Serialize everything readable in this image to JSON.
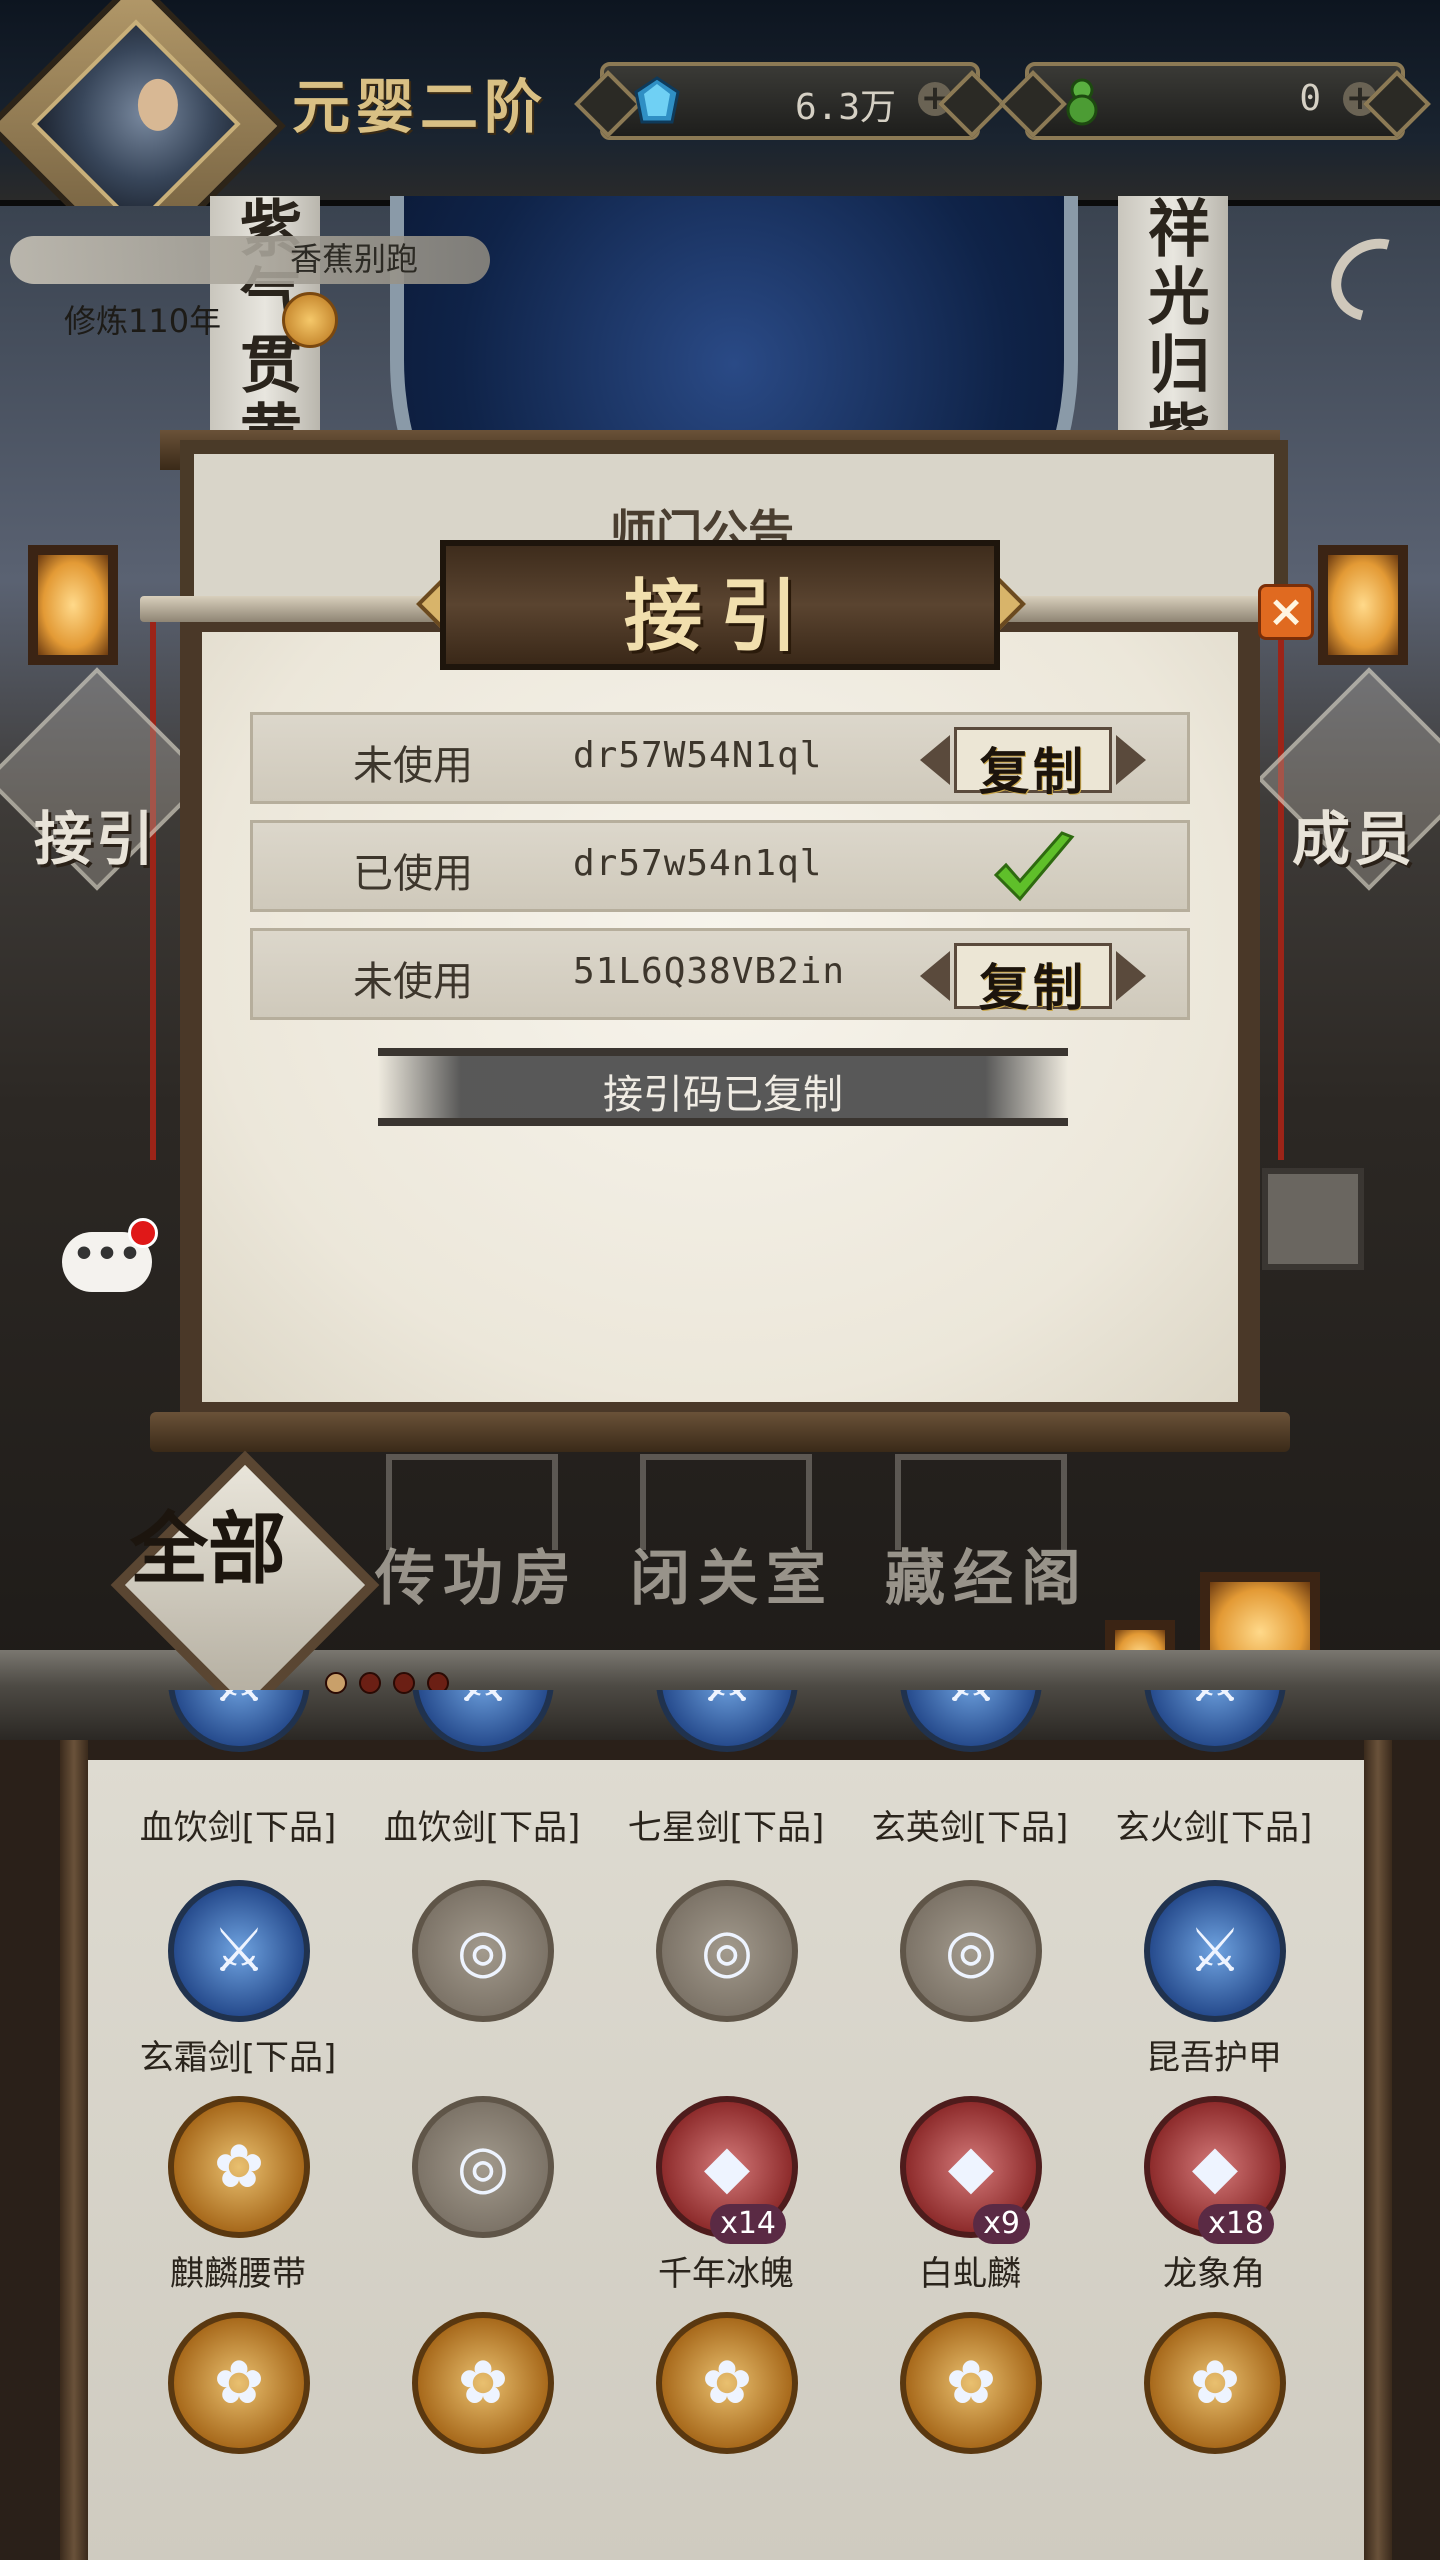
{
  "header": {
    "rank_title": "元婴二阶",
    "resources": [
      {
        "icon": "jade-icon",
        "value": "6.3万"
      },
      {
        "icon": "gourd-icon",
        "value": "0"
      }
    ],
    "plus_symbol": "+"
  },
  "player": {
    "name": "香蕉别跑",
    "cultivation": "修炼110年"
  },
  "scene": {
    "pillar_left_text": "紫气贯黄",
    "pillar_right_text": "祥光归紫",
    "left_side_button": "接引",
    "right_side_button": "成员",
    "notice_board_title": "师门公告"
  },
  "modal": {
    "title": "接引",
    "close_symbol": "×",
    "codes": [
      {
        "status": "未使用",
        "code": "dr57W54N1ql",
        "action": "复制",
        "used": false
      },
      {
        "status": "已使用",
        "code": "dr57w54n1ql",
        "action": "",
        "used": true
      },
      {
        "status": "未使用",
        "code": "51L6Q38VB2in",
        "action": "复制",
        "used": false
      }
    ],
    "toast": "接引码已复制"
  },
  "chat": {
    "bubble": "•••"
  },
  "buildings": {
    "all_tab": "全部",
    "tabs": [
      "传功房",
      "闭关室",
      "藏经阁"
    ],
    "page_count": 4,
    "active_page": 1
  },
  "inventory": {
    "rows": [
      [
        {
          "name": "血饮剑[下品]",
          "style": "blue",
          "count": ""
        },
        {
          "name": "血饮剑[下品]",
          "style": "blue",
          "count": ""
        },
        {
          "name": "七星剑[下品]",
          "style": "blue",
          "count": ""
        },
        {
          "name": "玄英剑[下品]",
          "style": "blue",
          "count": ""
        },
        {
          "name": "玄火剑[下品]",
          "style": "blue",
          "count": ""
        }
      ],
      [
        {
          "name": "玄霜剑[下品]",
          "style": "blue",
          "count": ""
        },
        {
          "name": "",
          "style": "empty",
          "count": ""
        },
        {
          "name": "",
          "style": "empty",
          "count": ""
        },
        {
          "name": "",
          "style": "empty",
          "count": ""
        },
        {
          "name": "昆吾护甲",
          "style": "blue",
          "count": ""
        }
      ],
      [
        {
          "name": "麒麟腰带",
          "style": "gold",
          "count": ""
        },
        {
          "name": "",
          "style": "empty",
          "count": ""
        },
        {
          "name": "千年冰魄",
          "style": "red",
          "count": "x14"
        },
        {
          "name": "白虬麟",
          "style": "red",
          "count": "x9"
        },
        {
          "name": "龙象角",
          "style": "red",
          "count": "x18"
        }
      ],
      [
        {
          "name": "",
          "style": "gold",
          "count": ""
        },
        {
          "name": "",
          "style": "gold",
          "count": ""
        },
        {
          "name": "",
          "style": "gold",
          "count": ""
        },
        {
          "name": "",
          "style": "gold",
          "count": ""
        },
        {
          "name": "",
          "style": "gold",
          "count": ""
        }
      ]
    ]
  },
  "colors": {
    "accent_gold": "#d9c084",
    "close_orange": "#e06a20",
    "check_green": "#5fbf2a"
  }
}
